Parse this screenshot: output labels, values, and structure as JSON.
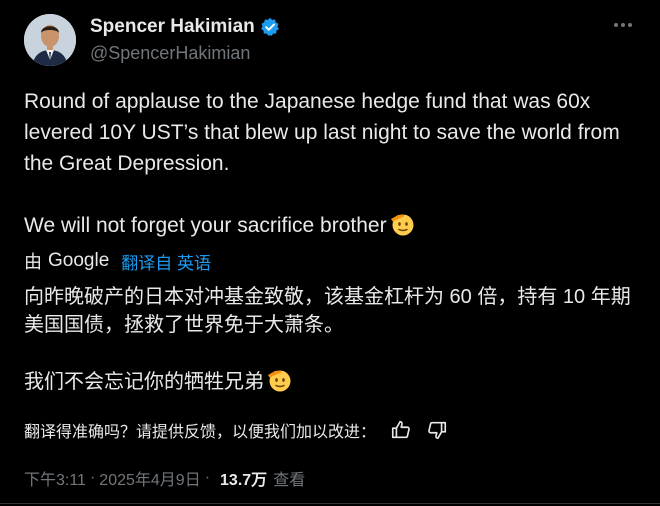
{
  "author": {
    "display_name": "Spencer Hakimian",
    "handle": "@SpencerHakimian"
  },
  "tweet": {
    "paragraph_1": "Round of applause to the Japanese hedge fund that was 60x levered 10Y UST’s that blew up last night to save the world from the Great Depression.",
    "paragraph_2": "We will not forget your sacrifice brother"
  },
  "translation": {
    "by_prefix": "由",
    "provider": "Google",
    "link_label": "翻译自 英语",
    "paragraph_1": "向昨晚破产的日本对冲基金致敬，该基金杠杆为 60 倍，持有 10 年期美国国债，拯救了世界免于大萧条。",
    "paragraph_2": "我们不会忘记你的牺牲兄弟"
  },
  "feedback": {
    "prompt": "翻译得准确吗？请提供反馈，以便我们加以改进："
  },
  "meta": {
    "time": "下午3:11",
    "separator_1": "·",
    "date": "2025年4月9日",
    "separator_2": "·",
    "views_count": "13.7万",
    "views_label": "查看"
  },
  "icons": {
    "verified": "verified-badge-icon",
    "more": "more-options-icon",
    "emoji": "saluting-face-emoji",
    "thumbs_up": "thumbs-up-icon",
    "thumbs_down": "thumbs-down-icon"
  },
  "colors": {
    "background": "#000000",
    "text": "#e7e9ea",
    "secondary_text": "#71767b",
    "accent": "#1d9bf0"
  }
}
